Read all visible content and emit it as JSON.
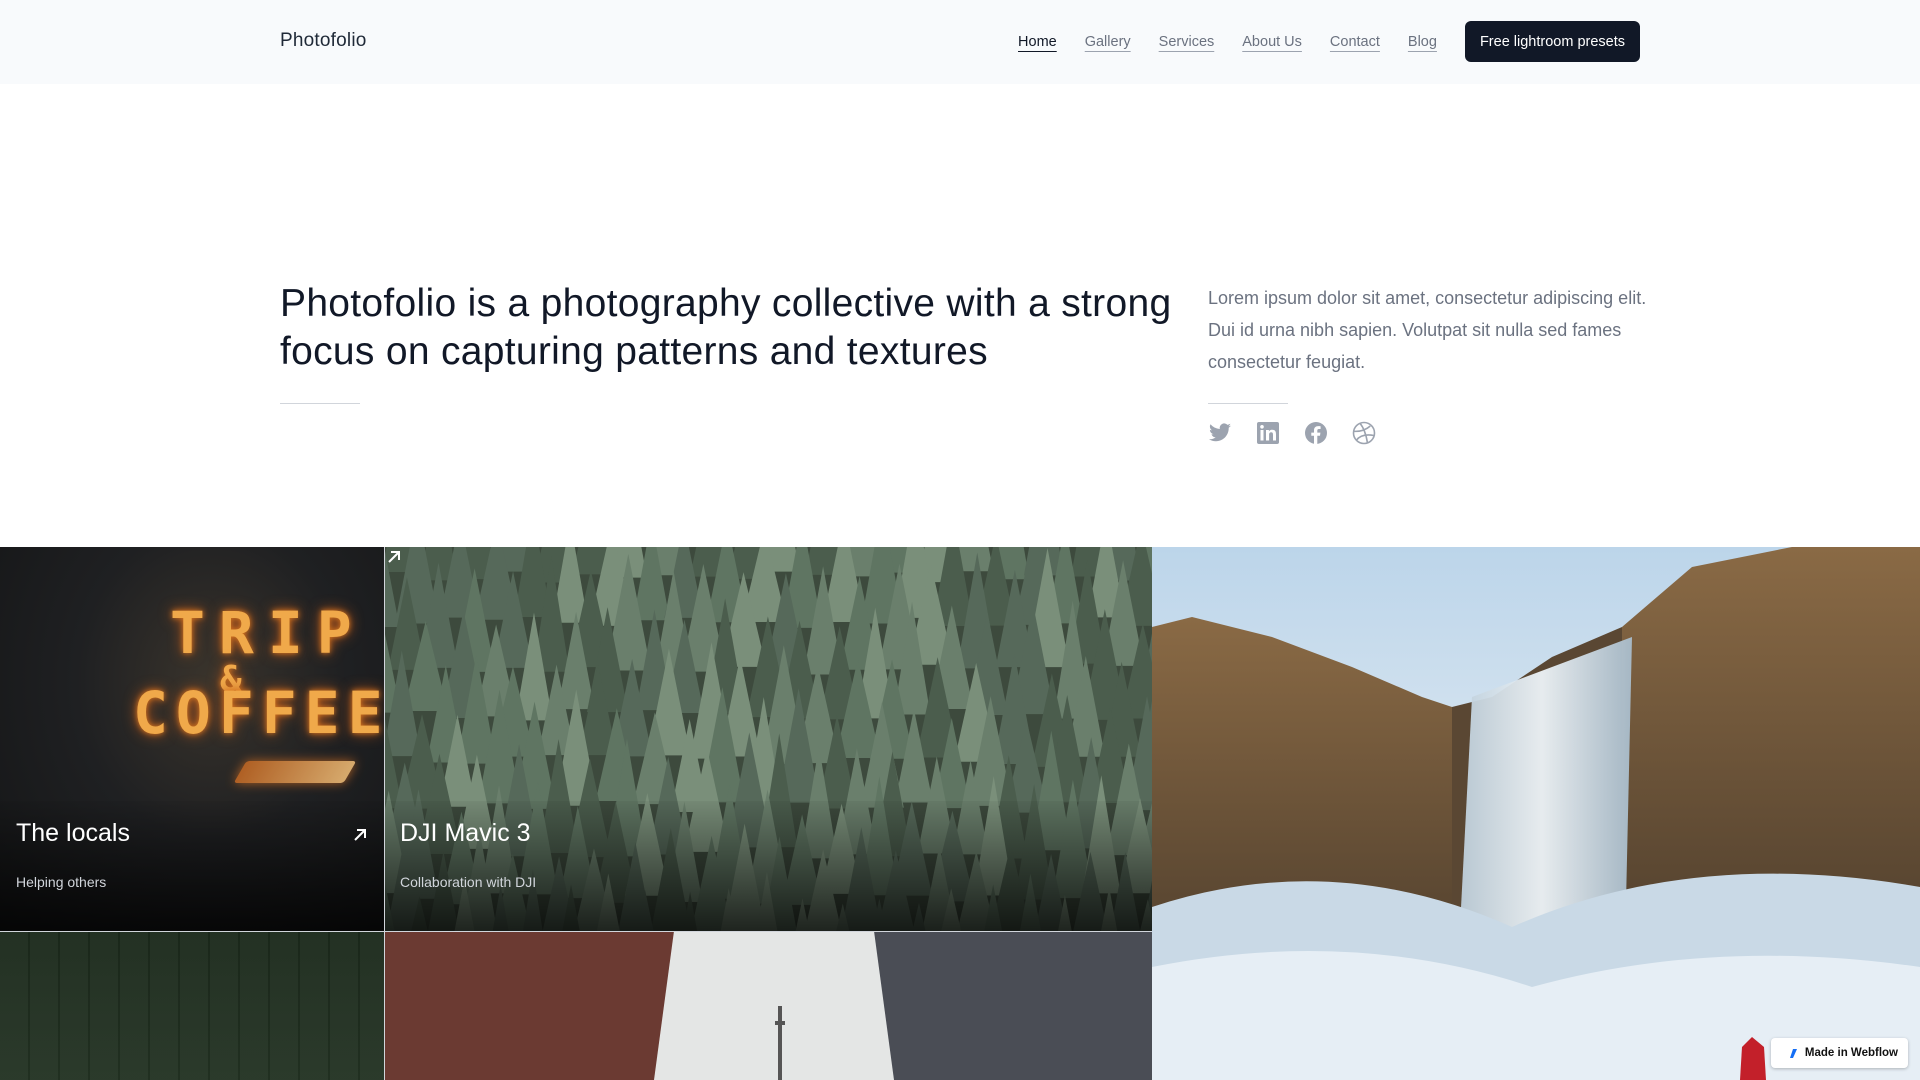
{
  "nav": {
    "brand": "Photofolio",
    "links": [
      "Home",
      "Gallery",
      "Services",
      "About Us",
      "Contact",
      "Blog"
    ],
    "cta": "Free lightroom presets"
  },
  "hero": {
    "title": "Photofolio is a photography collective with a strong focus on capturing patterns and textures",
    "text": "Lorem ipsum dolor sit amet, consectetur adipiscing elit. Dui id urna nibh sapien. Volutpat sit nulla sed fames consectetur feugiat.",
    "socials": [
      "twitter-icon",
      "linkedin-icon",
      "facebook-icon",
      "dribbble-icon"
    ]
  },
  "gallery": {
    "tiles": [
      {
        "title": "The locals",
        "subtitle": "Helping others",
        "image": "neon-sign"
      },
      {
        "title": "DJI Mavic 3",
        "subtitle": "Collaboration with DJI",
        "image": "pine-forest"
      },
      {
        "image": "waterfall"
      },
      {
        "image": "green-wall"
      },
      {
        "image": "city-buildings"
      }
    ],
    "neon_line1": "TRIP",
    "neon_line2": "&",
    "neon_line3": "COFFEE"
  },
  "badge": {
    "label": "Made in Webflow"
  },
  "colors": {
    "accent": "#111827",
    "muted": "#6b7280",
    "nav_bg": "#f8fafc"
  }
}
